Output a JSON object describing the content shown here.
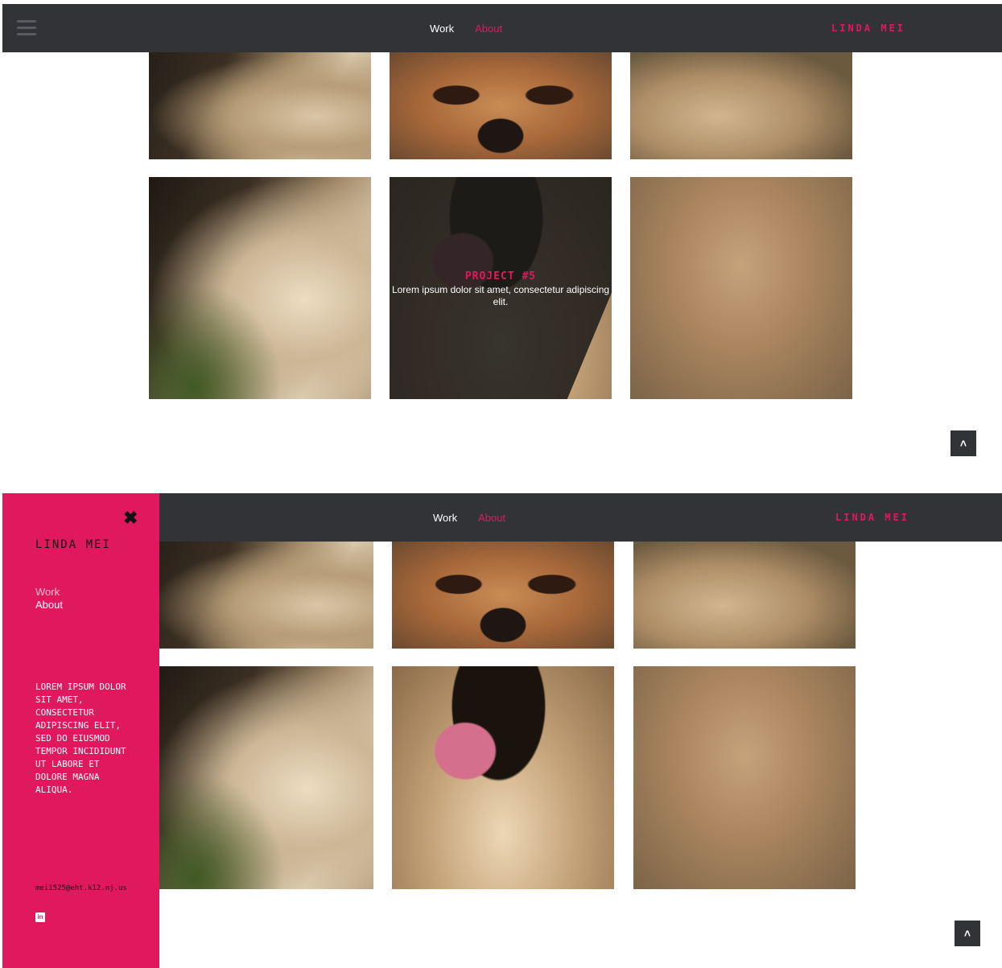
{
  "nav": {
    "work_label": "Work",
    "about_label": "About",
    "brand": "LINDA MEI"
  },
  "project_overlay": {
    "title": "PROJECT #5",
    "description": "Lorem ipsum dolor sit amet, consectetur adipiscing elit."
  },
  "side_menu": {
    "close_icon": "close-icon",
    "brand": "LINDA MEI",
    "work_label": "Work",
    "about_label": "About",
    "blurb": "Lorem ipsum dolor sit amet, consectetur adipiscing elit, sed do eiusmod tempor incididunt ut labore et dolore magna aliqua.",
    "email": "mei1525@eht.k12.nj.us",
    "linkedin_icon": "linkedin-icon",
    "linkedin_glyph": "in"
  },
  "scroll_top_icon": "double-chevron-up-icon",
  "colors": {
    "accent": "#e0195f",
    "navbar": "#323337"
  }
}
